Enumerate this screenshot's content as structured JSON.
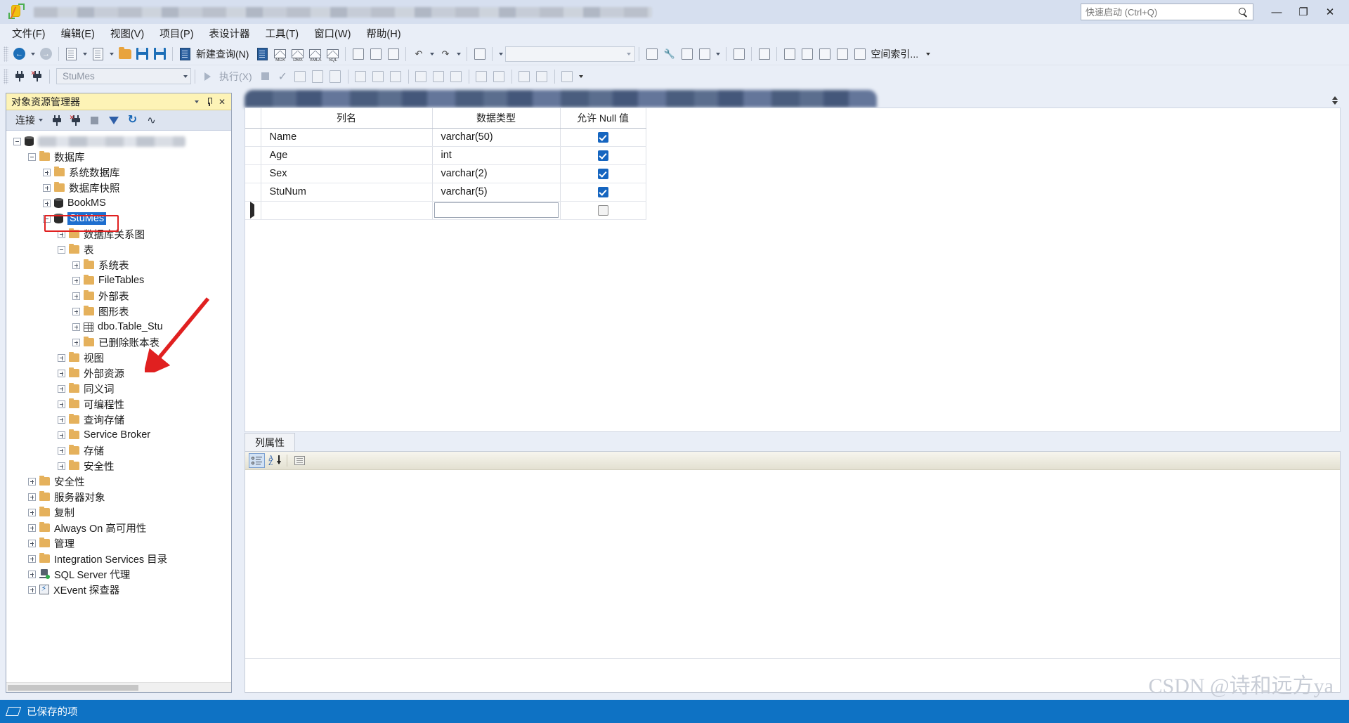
{
  "titlebar": {
    "quick_launch_placeholder": "快速启动 (Ctrl+Q)",
    "minimize": "—",
    "restore": "❐",
    "close": "✕"
  },
  "menubar": {
    "items": [
      {
        "label": "文件(F)"
      },
      {
        "label": "编辑(E)"
      },
      {
        "label": "视图(V)"
      },
      {
        "label": "项目(P)"
      },
      {
        "label": "表设计器"
      },
      {
        "label": "工具(T)"
      },
      {
        "label": "窗口(W)"
      },
      {
        "label": "帮助(H)"
      }
    ]
  },
  "toolbar": {
    "new_query_label": "新建查询(N)",
    "mdx_label": "MDX",
    "dmx_label": "DMX",
    "xmla_label": "XMLA",
    "sql_label": "SQL",
    "spatial_label": "空间索引...",
    "combo_value": ""
  },
  "toolbar2": {
    "database": "StuMes",
    "execute_label": "执行(X)"
  },
  "object_explorer": {
    "title": "对象资源管理器",
    "connect_label": "连接",
    "toolbar_icons": [
      "connect-icon",
      "disconnect-icon",
      "stop-icon",
      "filter-icon",
      "refresh-icon",
      "activity-monitor-icon"
    ],
    "tree": [
      {
        "label": "",
        "indent": 0,
        "expander": "minus",
        "icon": "server-icon",
        "blurred": true,
        "selected": false
      },
      {
        "label": "数据库",
        "indent": 1,
        "expander": "minus",
        "icon": "folder-icon",
        "selected": false
      },
      {
        "label": "系统数据库",
        "indent": 2,
        "expander": "plus",
        "icon": "folder-icon",
        "selected": false
      },
      {
        "label": "数据库快照",
        "indent": 2,
        "expander": "plus",
        "icon": "folder-icon",
        "selected": false
      },
      {
        "label": "BookMS",
        "indent": 2,
        "expander": "plus",
        "icon": "database-icon",
        "selected": false
      },
      {
        "label": "StuMes",
        "indent": 2,
        "expander": "minus",
        "icon": "database-icon",
        "selected": true
      },
      {
        "label": "数据库关系图",
        "indent": 3,
        "expander": "plus",
        "icon": "folder-icon",
        "selected": false
      },
      {
        "label": "表",
        "indent": 3,
        "expander": "minus",
        "icon": "folder-icon",
        "selected": false
      },
      {
        "label": "系统表",
        "indent": 4,
        "expander": "plus",
        "icon": "folder-icon",
        "selected": false
      },
      {
        "label": "FileTables",
        "indent": 4,
        "expander": "plus",
        "icon": "folder-icon",
        "selected": false
      },
      {
        "label": "外部表",
        "indent": 4,
        "expander": "plus",
        "icon": "folder-icon",
        "selected": false
      },
      {
        "label": "图形表",
        "indent": 4,
        "expander": "plus",
        "icon": "folder-icon",
        "selected": false
      },
      {
        "label": "dbo.Table_Stu",
        "indent": 4,
        "expander": "plus",
        "icon": "table-icon",
        "selected": false
      },
      {
        "label": "已删除账本表",
        "indent": 4,
        "expander": "plus",
        "icon": "folder-icon",
        "selected": false
      },
      {
        "label": "视图",
        "indent": 3,
        "expander": "plus",
        "icon": "folder-icon",
        "selected": false
      },
      {
        "label": "外部资源",
        "indent": 3,
        "expander": "plus",
        "icon": "folder-icon",
        "selected": false
      },
      {
        "label": "同义词",
        "indent": 3,
        "expander": "plus",
        "icon": "folder-icon",
        "selected": false
      },
      {
        "label": "可编程性",
        "indent": 3,
        "expander": "plus",
        "icon": "folder-icon",
        "selected": false
      },
      {
        "label": "查询存储",
        "indent": 3,
        "expander": "plus",
        "icon": "folder-icon",
        "selected": false
      },
      {
        "label": "Service Broker",
        "indent": 3,
        "expander": "plus",
        "icon": "folder-icon",
        "selected": false
      },
      {
        "label": "存储",
        "indent": 3,
        "expander": "plus",
        "icon": "folder-icon",
        "selected": false
      },
      {
        "label": "安全性",
        "indent": 3,
        "expander": "plus",
        "icon": "folder-icon",
        "selected": false
      },
      {
        "label": "安全性",
        "indent": 1,
        "expander": "plus",
        "icon": "folder-icon",
        "selected": false
      },
      {
        "label": "服务器对象",
        "indent": 1,
        "expander": "plus",
        "icon": "folder-icon",
        "selected": false
      },
      {
        "label": "复制",
        "indent": 1,
        "expander": "plus",
        "icon": "folder-icon",
        "selected": false
      },
      {
        "label": "Always On 高可用性",
        "indent": 1,
        "expander": "plus",
        "icon": "folder-icon",
        "selected": false
      },
      {
        "label": "管理",
        "indent": 1,
        "expander": "plus",
        "icon": "folder-icon",
        "selected": false
      },
      {
        "label": "Integration Services 目录",
        "indent": 1,
        "expander": "plus",
        "icon": "folder-icon",
        "selected": false
      },
      {
        "label": "SQL Server 代理",
        "indent": 1,
        "expander": "plus",
        "icon": "agent-icon",
        "selected": false
      },
      {
        "label": "XEvent 探查器",
        "indent": 1,
        "expander": "plus",
        "icon": "xevent-icon",
        "selected": false
      }
    ]
  },
  "designer": {
    "columns": [
      "列名",
      "数据类型",
      "允许 Null 值"
    ],
    "rows": [
      {
        "name": "Name",
        "type": "varchar(50)",
        "allow_null": true,
        "current": false
      },
      {
        "name": "Age",
        "type": "int",
        "allow_null": true,
        "current": false
      },
      {
        "name": "Sex",
        "type": "varchar(2)",
        "allow_null": true,
        "current": false
      },
      {
        "name": "StuNum",
        "type": "varchar(5)",
        "allow_null": true,
        "current": false
      },
      {
        "name": "",
        "type": "",
        "allow_null": false,
        "current": true
      }
    ]
  },
  "column_properties": {
    "tab_label": "列属性",
    "toolbar_icons": [
      "categorized-icon",
      "alphabetical-sort-icon",
      "property-pages-icon"
    ]
  },
  "statusbar": {
    "text": "已保存的项",
    "icon": "saved-items-icon"
  },
  "watermark": {
    "text": "CSDN @诗和远方ya"
  },
  "annotations": {
    "highlight_rect_target": "StuMes",
    "arrow_target": "dbo.Table_Stu",
    "color": "#e02020"
  }
}
